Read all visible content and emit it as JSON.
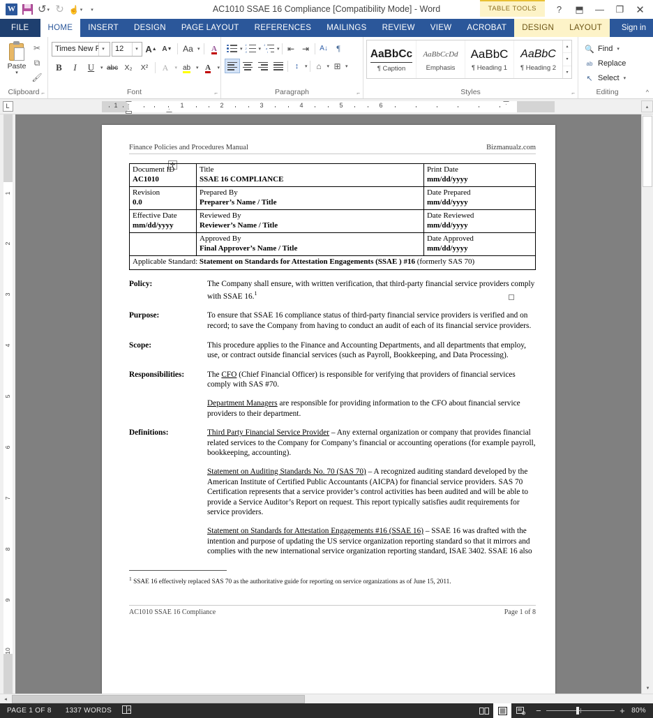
{
  "window": {
    "title": "AC1010 SSAE 16 Compliance [Compatibility Mode] - Word",
    "contextual_tab_group": "TABLE TOOLS",
    "help_icon": "?",
    "ribbon_display_icon": "⬒",
    "minimize_icon": "—",
    "restore_icon": "❐",
    "close_icon": "✕"
  },
  "qat": {
    "word_icon": "W",
    "save_icon": "save-icon",
    "undo_icon": "↺",
    "redo_icon": "↻",
    "touch_icon": "☝",
    "more_caret": "▾"
  },
  "tabs": [
    {
      "label": "FILE",
      "active": false
    },
    {
      "label": "HOME",
      "active": true
    },
    {
      "label": "INSERT",
      "active": false
    },
    {
      "label": "DESIGN",
      "active": false
    },
    {
      "label": "PAGE LAYOUT",
      "active": false
    },
    {
      "label": "REFERENCES",
      "active": false
    },
    {
      "label": "MAILINGS",
      "active": false
    },
    {
      "label": "REVIEW",
      "active": false
    },
    {
      "label": "VIEW",
      "active": false
    },
    {
      "label": "ACROBAT",
      "active": false
    },
    {
      "label": "DESIGN",
      "active": false
    },
    {
      "label": "LAYOUT",
      "active": false
    }
  ],
  "signin": "Sign in",
  "ribbon": {
    "clipboard": {
      "group_label": "Clipboard",
      "paste_label": "Paste",
      "paste_caret": "▾",
      "cut_icon": "✂",
      "copy_icon": "⧉",
      "format_painter_icon": "🖌",
      "dialog_launcher": "⌐"
    },
    "font": {
      "group_label": "Font",
      "font_name": "Times New Ro",
      "font_size": "12",
      "grow_font": "A",
      "shrink_font": "A",
      "change_case": "Aa",
      "clear_formatting": "A",
      "bold": "B",
      "italic": "I",
      "underline": "U",
      "strikethrough": "abc",
      "subscript": "X₂",
      "superscript": "X²",
      "text_effects": "A",
      "highlight": "ab",
      "font_color": "A",
      "caret": "▾",
      "dialog_launcher": "⌐"
    },
    "paragraph": {
      "group_label": "Paragraph",
      "bullets": "bullet-list-icon",
      "numbering": "numbered-list-icon",
      "multilevel": "multilevel-list-icon",
      "decrease_indent": "⇤",
      "increase_indent": "⇥",
      "sort": "A↓",
      "show_marks": "¶",
      "align_left": "align-left-icon",
      "align_center": "align-center-icon",
      "align_right": "align-right-icon",
      "justify": "justify-icon",
      "line_spacing": "↕",
      "shading": "shading-icon",
      "borders": "borders-icon",
      "caret": "▾",
      "dialog_launcher": "⌐"
    },
    "styles": {
      "group_label": "Styles",
      "items": [
        {
          "preview": "AaBbCc",
          "name": "¶ Caption"
        },
        {
          "preview": "AaBbCcDd",
          "name": "Emphasis"
        },
        {
          "preview": "AaBbC",
          "name": "¶ Heading 1"
        },
        {
          "preview": "AaBbC",
          "name": "¶ Heading 2"
        }
      ],
      "scroll_up": "▴",
      "scroll_down": "▾",
      "more": "▾",
      "dialog_launcher": "⌐"
    },
    "editing": {
      "group_label": "Editing",
      "find_label": "Find",
      "find_icon": "🔍",
      "find_caret": "▾",
      "replace_label": "Replace",
      "replace_icon": "ab",
      "select_label": "Select",
      "select_icon": "↖",
      "select_caret": "▾"
    },
    "collapse_icon": "^"
  },
  "ruler": {
    "tab_selector": "L",
    "horizontal_numbers": [
      "1",
      "1",
      "2",
      "3",
      "4",
      "5",
      "6"
    ],
    "vertical_numbers": [
      "1",
      "2",
      "3",
      "4",
      "5",
      "6",
      "7",
      "8",
      "9",
      "10"
    ],
    "scroll_up_icon": "▴"
  },
  "document": {
    "header": {
      "left": "Finance Policies and Procedures Manual",
      "right": "Bizmanualz.com"
    },
    "table_handle_icon": "✛",
    "info_table": {
      "rows": [
        {
          "cells": [
            {
              "label": "Document ID",
              "value": "AC1010"
            },
            {
              "label": "Title",
              "value": "SSAE 16 COMPLIANCE"
            },
            {
              "label": "Print Date",
              "value": "mm/dd/yyyy"
            }
          ]
        },
        {
          "cells": [
            {
              "label": "Revision",
              "value": "0.0"
            },
            {
              "label": "Prepared By",
              "value": "Preparer’s Name / Title"
            },
            {
              "label": "Date Prepared",
              "value": "mm/dd/yyyy"
            }
          ]
        },
        {
          "cells": [
            {
              "label": "Effective Date",
              "value": "mm/dd/yyyy"
            },
            {
              "label": "Reviewed By",
              "value": "Reviewer’s Name / Title"
            },
            {
              "label": "Date Reviewed",
              "value": "mm/dd/yyyy"
            }
          ]
        },
        {
          "cells": [
            {
              "label": "",
              "value": ""
            },
            {
              "label": "Approved By",
              "value": "Final Approver’s Name / Title"
            },
            {
              "label": "Date Approved",
              "value": "mm/dd/yyyy"
            }
          ]
        }
      ],
      "standard_label": "Applicable Standard:",
      "standard_bold": "Statement on Standards for Attestation Engagements (SSAE ) #16",
      "standard_tail": " (formerly SAS 70)"
    },
    "sections": [
      {
        "label": "Policy:",
        "paragraphs": [
          "The Company shall ensure, with written verification, that third-party financial service providers comply with SSAE 16."
        ]
      },
      {
        "label": "Purpose:",
        "paragraphs": [
          "To ensure that SSAE 16 compliance status of third-party financial service providers is verified and on record; to save the Company from having to conduct an audit of each of its financial service providers."
        ]
      },
      {
        "label": "Scope:",
        "paragraphs": [
          "This procedure applies to the Finance and Accounting Departments, and all departments that employ, use, or contract outside financial services (such as Payroll, Bookkeeping, and Data Processing)."
        ]
      },
      {
        "label": "Responsibilities:",
        "paragraphs": [
          "The CFO (Chief Financial Officer) is responsible for verifying that providers of financial services comply with SAS #70.",
          "Department Managers are responsible for providing information to the CFO about financial service providers to their department."
        ]
      },
      {
        "label": "Definitions:",
        "paragraphs": [
          "Third Party Financial Service Provider – Any external organization or company that provides financial related services to the Company for Company’s financial or accounting operations (for example payroll, bookkeeping, accounting).",
          "Statement on Auditing Standards No. 70 (SAS 70) – A recognized auditing standard developed by the American Institute of Certified Public Accountants (AICPA) for financial service providers.  SAS 70 Certification represents that a service provider’s control activities has been audited and will be able to provide a Service Auditor’s Report on request.  This report typically satisfies audit requirements for service providers.",
          "Statement on Standards for Attestation Engagements #16 (SSAE 16) – SSAE 16 was drafted with the intention and purpose of updating the US service organization reporting standard so that it mirrors and complies with the new international service organization reporting standard, ISAE 3402. SSAE 16 also"
        ]
      }
    ],
    "footnote": {
      "marker": "1",
      "text": " SSAE 16  effectively replaced SAS 70 as the authoritative guide for reporting on service organizations as of June 15, 2011."
    },
    "footer": {
      "left": "AC1010 SSAE 16 Compliance",
      "right": "Page 1 of 8"
    }
  },
  "statusbar": {
    "page_label": "PAGE 1 OF 8",
    "word_count": "1337 WORDS",
    "proofing_icon": "proofing-errors-icon",
    "read_mode_icon": "read-mode-icon",
    "print_layout_icon": "print-layout-icon",
    "web_layout_icon": "web-layout-icon",
    "zoom_out": "−",
    "zoom_in": "+",
    "zoom_level": "80%"
  }
}
